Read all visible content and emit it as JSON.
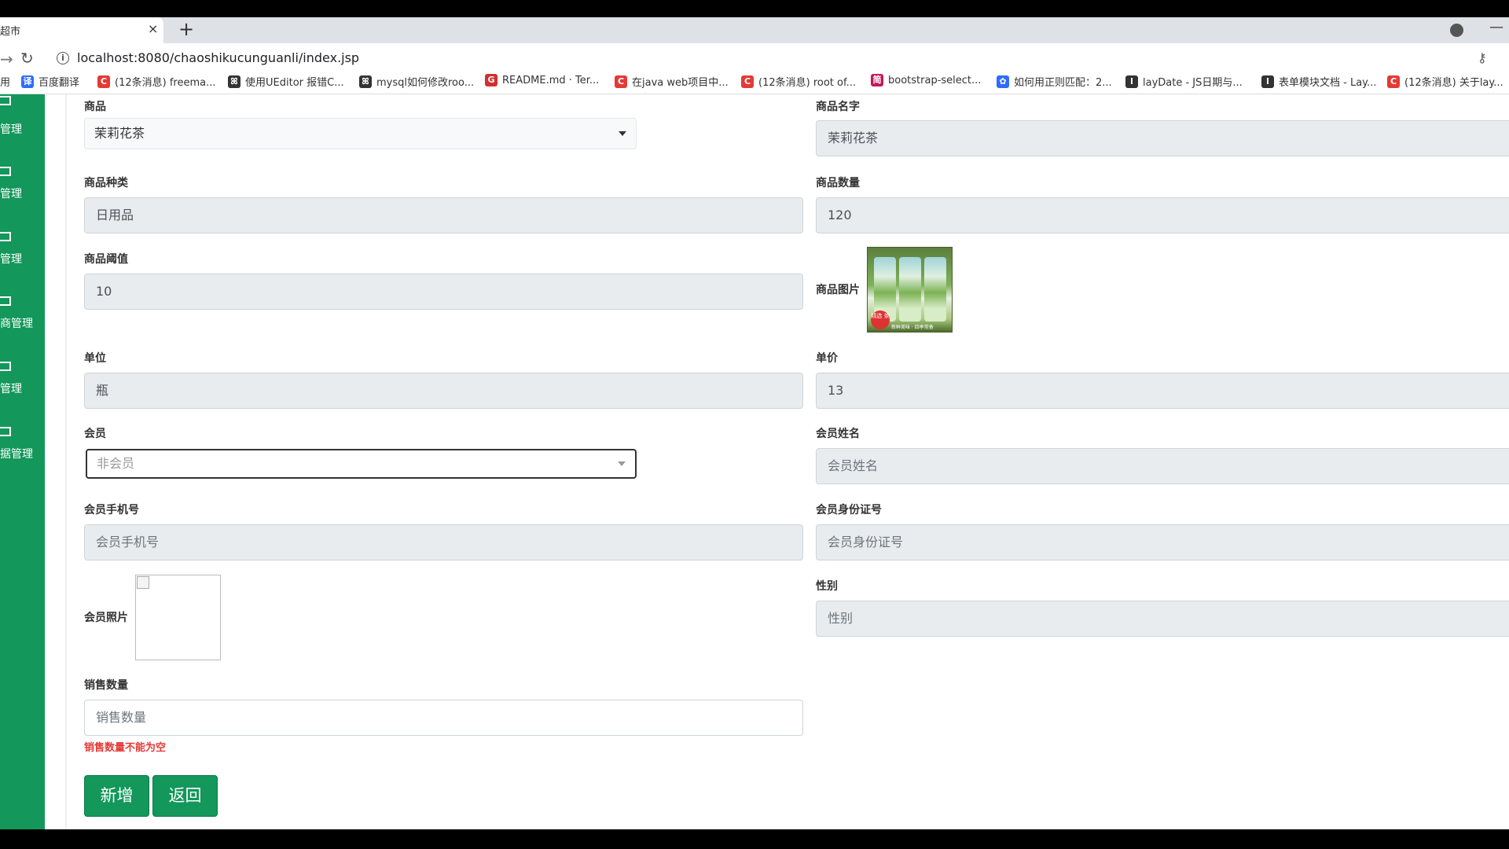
{
  "browser": {
    "tab_title": "超市",
    "tab_close": "×",
    "new_tab": "+",
    "url": "localhost:8080/chaoshikucunguanli/index.jsp",
    "minimize": "—"
  },
  "bookmarks": [
    {
      "label": "用",
      "icon": "",
      "color": "#ffffff"
    },
    {
      "label": "百度翻译",
      "icon": "译",
      "color": "#2f6bff"
    },
    {
      "label": "(12条消息) freema...",
      "icon": "C",
      "color": "#e53935"
    },
    {
      "label": "使用UEditor 报错C...",
      "icon": "ꕤ",
      "color": "#333333"
    },
    {
      "label": "mysql如何修改roo...",
      "icon": "ꕤ",
      "color": "#333333"
    },
    {
      "label": "README.md · Ter...",
      "icon": "G",
      "color": "#d32f2f"
    },
    {
      "label": "在java web项目中...",
      "icon": "C",
      "color": "#e53935"
    },
    {
      "label": "(12条消息) root of...",
      "icon": "C",
      "color": "#e53935"
    },
    {
      "label": "bootstrap-select...",
      "icon": "简",
      "color": "#c2185b"
    },
    {
      "label": "如何用正则匹配：2...",
      "icon": "✿",
      "color": "#2f6bff"
    },
    {
      "label": "layDate - JS日期与...",
      "icon": "l",
      "color": "#333333"
    },
    {
      "label": "表单模块文档 - Lay...",
      "icon": "l",
      "color": "#333333"
    },
    {
      "label": "(12条消息) 关于lay...",
      "icon": "C",
      "color": "#e53935"
    }
  ],
  "sidebar": [
    {
      "label": "管理"
    },
    {
      "label": "管理"
    },
    {
      "label": "管理"
    },
    {
      "label": "商管理"
    },
    {
      "label": "管理"
    },
    {
      "label": "据管理"
    }
  ],
  "form": {
    "product_label": "商品",
    "product_value": "茉莉花茶",
    "product_name_label": "商品名字",
    "product_name_value": "茉莉花茶",
    "category_label": "商品种类",
    "category_value": "日用品",
    "quantity_label": "商品数量",
    "quantity_value": "120",
    "threshold_label": "商品阈值",
    "threshold_value": "10",
    "image_label": "商品图片",
    "image_badge": "精选 茶",
    "image_caption": "新鲜美味 · 四季常备",
    "unit_label": "单位",
    "unit_value": "瓶",
    "price_label": "单价",
    "price_value": "13",
    "member_label": "会员",
    "member_value": "非会员",
    "member_name_label": "会员姓名",
    "member_name_placeholder": "会员姓名",
    "member_phone_label": "会员手机号",
    "member_phone_placeholder": "会员手机号",
    "member_id_label": "会员身份证号",
    "member_id_placeholder": "会员身份证号",
    "member_photo_label": "会员照片",
    "gender_label": "性别",
    "gender_placeholder": "性别",
    "sales_qty_label": "销售数量",
    "sales_qty_placeholder": "销售数量",
    "sales_qty_error": "销售数量不能为空",
    "add_button": "新增",
    "back_button": "返回"
  },
  "colors": {
    "sidebar": "#13975b",
    "error": "#e53935"
  }
}
